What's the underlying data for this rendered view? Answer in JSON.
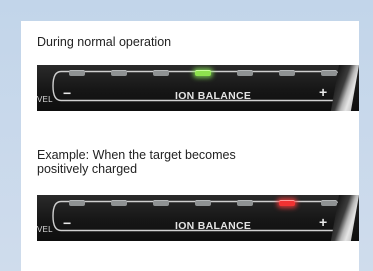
{
  "caption_normal": "During normal operation",
  "caption_example": "Example: When the target becomes positively charged",
  "panel_label": "ION BALANCE",
  "minus_sign": "−",
  "plus_sign": "+",
  "edge_text": "VEL",
  "led_count": 7,
  "colors": {
    "led_off": "#8f9293",
    "led_green": "#8ee24e",
    "led_red": "#f23232"
  },
  "panels": [
    {
      "lit_index": 3,
      "lit_color": "green"
    },
    {
      "lit_index": 5,
      "lit_color": "red"
    }
  ]
}
